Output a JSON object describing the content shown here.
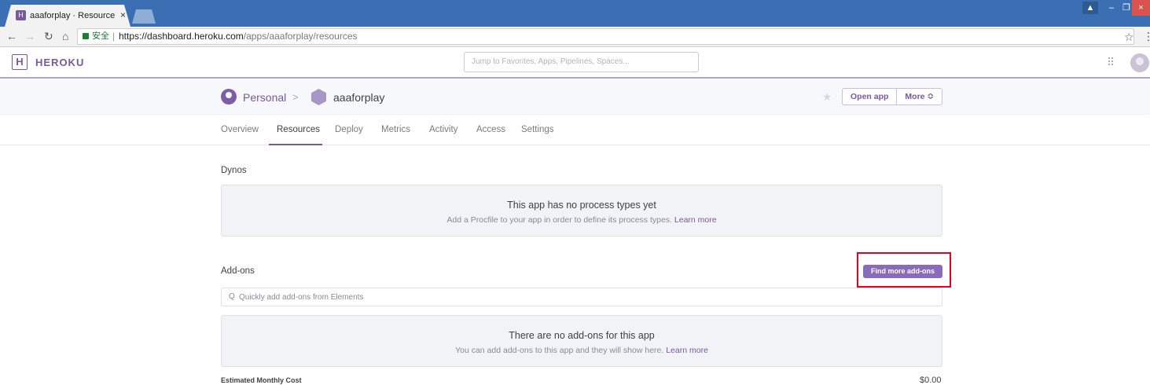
{
  "browser": {
    "tab_title": "aaaforplay · Resources",
    "tab_close": "×",
    "secure_label": "安全",
    "separator": "|",
    "url_base": "https://dashboard.heroku.com",
    "url_path": "/apps/aaaforplay/resources",
    "icons": [
      "back-arrow-icon",
      "forward-arrow-icon",
      "reload-icon",
      "home-icon",
      "lock-icon",
      "star-icon",
      "menu-dots-icon"
    ]
  },
  "window_controls": {
    "minimize": "–",
    "maximize": "❐",
    "close": "×",
    "user": "▲"
  },
  "heroku_header": {
    "logo_letter": "H",
    "logo_text": "HEROKU",
    "search_placeholder": "Jump to Favorites, Apps, Pipelines, Spaces..."
  },
  "app_header": {
    "breadcrumb_owner": "Personal",
    "breadcrumb_separator": ">",
    "app_name": "aaaforplay",
    "open_app_label": "Open app",
    "more_label": "More ≎"
  },
  "tabs": [
    {
      "label": "Overview",
      "active": false
    },
    {
      "label": "Resources",
      "active": true
    },
    {
      "label": "Deploy",
      "active": false
    },
    {
      "label": "Metrics",
      "active": false
    },
    {
      "label": "Activity",
      "active": false
    },
    {
      "label": "Access",
      "active": false
    },
    {
      "label": "Settings",
      "active": false
    }
  ],
  "dynos": {
    "title": "Dynos",
    "empty_heading": "This app has no process types yet",
    "empty_text": "Add a Procfile to your app in order to define its process types.",
    "learn_more": "Learn more"
  },
  "addons": {
    "title": "Add-ons",
    "find_button": "Find more add-ons",
    "search_placeholder": "Quickly add add-ons from Elements",
    "empty_heading": "There are no add-ons for this app",
    "empty_text": "You can add add-ons to this app and they will show here.",
    "learn_more": "Learn more"
  },
  "cost": {
    "label": "Estimated Monthly Cost",
    "value": "$0.00"
  },
  "colors": {
    "accent": "#79589f",
    "highlight": "#e8001c",
    "titlebar": "#3b6fb4"
  }
}
